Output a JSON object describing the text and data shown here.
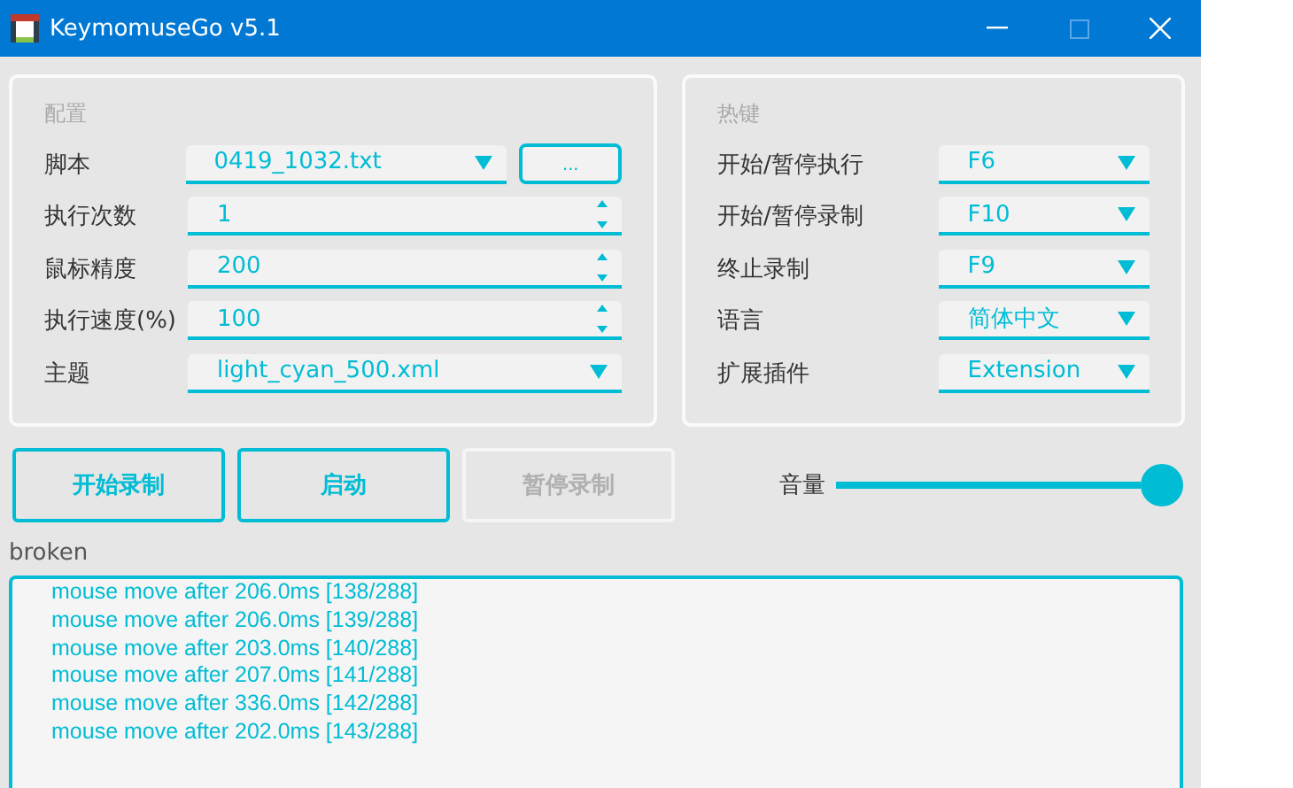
{
  "window": {
    "title": "KeymomuseGo v5.1"
  },
  "config": {
    "title": "配置",
    "rows": [
      {
        "label": "脚本",
        "kind": "select",
        "value": "0419_1032.txt",
        "browse": "..."
      },
      {
        "label": "执行次数",
        "kind": "spin",
        "value": "1"
      },
      {
        "label": "鼠标精度",
        "kind": "spin",
        "value": "200"
      },
      {
        "label": "执行速度(%)",
        "kind": "spin",
        "value": "100"
      },
      {
        "label": "主题",
        "kind": "select",
        "value": "light_cyan_500.xml"
      }
    ]
  },
  "hotkeys": {
    "title": "热键",
    "rows": [
      {
        "label": "开始/暂停执行",
        "value": "F6"
      },
      {
        "label": "开始/暂停录制",
        "value": "F10"
      },
      {
        "label": "终止录制",
        "value": "F9"
      },
      {
        "label": "语言",
        "value": "简体中文"
      },
      {
        "label": "扩展插件",
        "value": "Extension"
      }
    ]
  },
  "buttons": [
    {
      "label": "开始录制",
      "disabled": false
    },
    {
      "label": "启动",
      "disabled": false
    },
    {
      "label": "暂停录制",
      "disabled": true
    }
  ],
  "volume": {
    "label": "音量",
    "level": 1.0
  },
  "status": "broken",
  "log": [
    "mouse move after 206.0ms [138/288]",
    "mouse move after 206.0ms [139/288]",
    "mouse move after 203.0ms [140/288]",
    "mouse move after 207.0ms [141/288]",
    "mouse move after 336.0ms [142/288]",
    "mouse move after 202.0ms [143/288]"
  ]
}
